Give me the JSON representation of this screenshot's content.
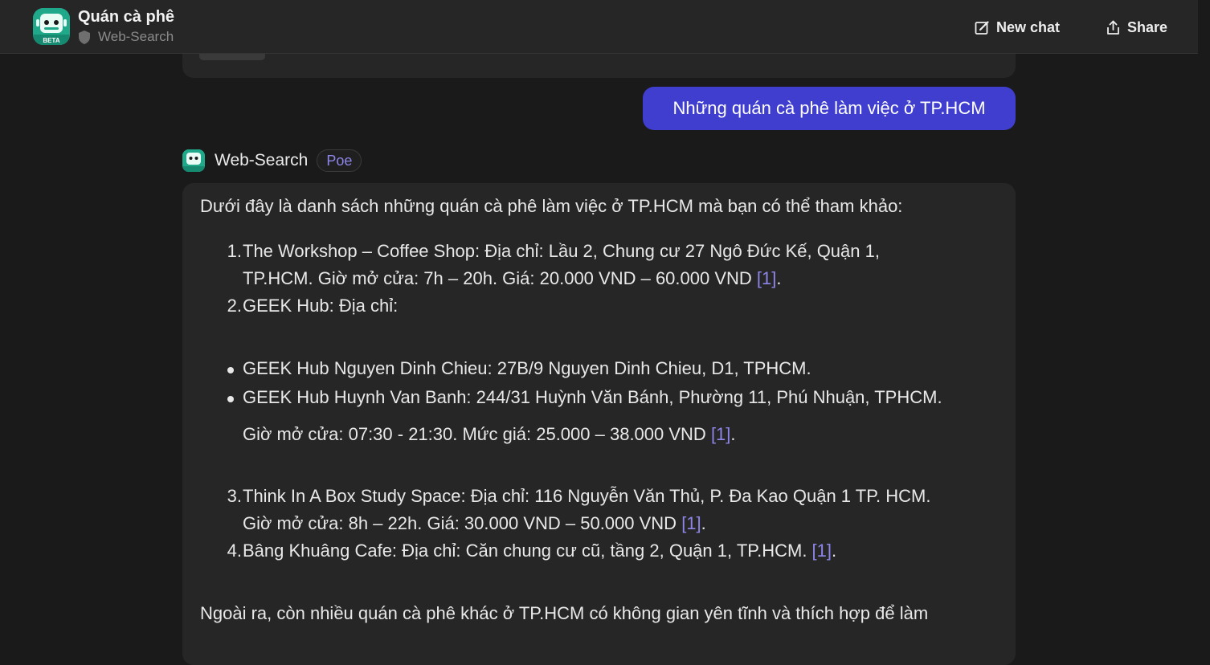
{
  "header": {
    "chat_title": "Quán cà phê",
    "bot_name": "Web-Search",
    "new_chat_label": "New chat",
    "share_label": "Share",
    "avatar_badge": "BETA"
  },
  "colors": {
    "accent": "#3f3ecf",
    "link": "#8d85e8",
    "bot_avatar": "#1fa98a"
  },
  "user_message": "Những quán cà phê làm việc ở TP.HCM",
  "bot_message": {
    "bot_name": "Web-Search",
    "badge": "Poe",
    "intro": "Dưới đây là danh sách những quán cà phê làm việc ở TP.HCM mà bạn có thể tham khảo:",
    "items": [
      {
        "num": "1.",
        "line1": "The Workshop – Coffee Shop: Địa chỉ: Lầu 2, Chung cư 27 Ngô Đức Kế, Quận 1,",
        "line2": "TP.HCM. Giờ mở cửa: 7h – 20h. Giá: 20.000 VND – 60.000 VND ",
        "cite": "[1]",
        "tail": "."
      },
      {
        "num": "2.",
        "line1": "GEEK Hub: Địa chỉ:"
      }
    ],
    "bullets": [
      "GEEK Hub Nguyen Dinh Chieu: 27B/9 Nguyen Dinh Chieu, D1, TPHCM.",
      "GEEK Hub Huynh Van Banh: 244/31 Huỳnh Văn Bánh, Phường 11, Phú Nhuận, TPHCM."
    ],
    "geek_hours": "Giờ mở cửa: 07:30 - 21:30. Mức giá: 25.000 – 38.000 VND ",
    "geek_cite": "[1]",
    "geek_tail": ".",
    "items_after": [
      {
        "num": "3.",
        "line1": "Think In A Box Study Space: Địa chỉ: 116 Nguyễn Văn Thủ, P. Đa Kao Quận 1 TP. HCM.",
        "line2": "Giờ mở cửa: 8h – 22h. Giá: 30.000 VND – 50.000 VND ",
        "cite": "[1]",
        "tail": "."
      },
      {
        "num": "4.",
        "line1": "Bâng Khuâng Cafe: Địa chỉ: Căn chung cư cũ, tầng 2, Quận 1, TP.HCM. ",
        "cite": "[1]",
        "tail": "."
      }
    ],
    "outro": "Ngoài ra, còn nhiều quán cà phê khác ở TP.HCM có không gian yên tĩnh và thích hợp để làm"
  }
}
